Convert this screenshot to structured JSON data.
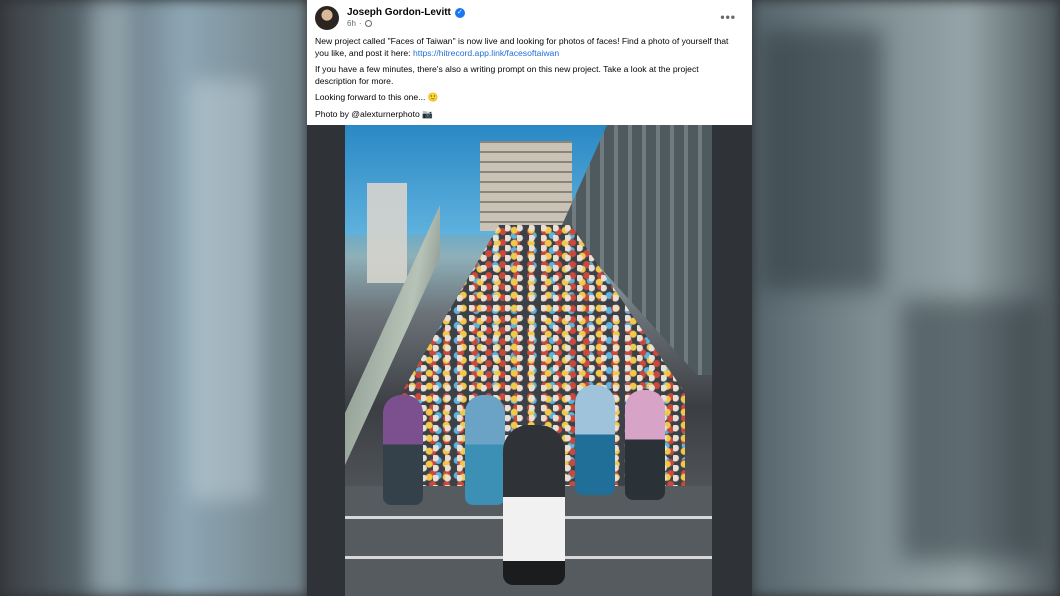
{
  "post": {
    "author": "Joseph Gordon-Levitt",
    "time": "6h",
    "more_label": "•••",
    "paragraph1_text": "New project called \"Faces of Taiwan\" is now live and looking for photos of faces! Find a photo of yourself that you like, and post it here: ",
    "paragraph1_link": "https://hitrecord.app.link/facesoftaiwan",
    "paragraph2": "If you have a few minutes, there's also a writing prompt on this new project. Take a look at the project description for more.",
    "paragraph3": "Looking forward to this one... 🙂",
    "paragraph4": "Photo by @alexturnerphoto 📷"
  },
  "icons": {
    "verified": "verified-badge-icon",
    "privacy": "globe-icon",
    "more": "more-options-icon"
  },
  "colors": {
    "link": "#216fdb",
    "verified": "#1877f2",
    "meta": "#65676b"
  }
}
